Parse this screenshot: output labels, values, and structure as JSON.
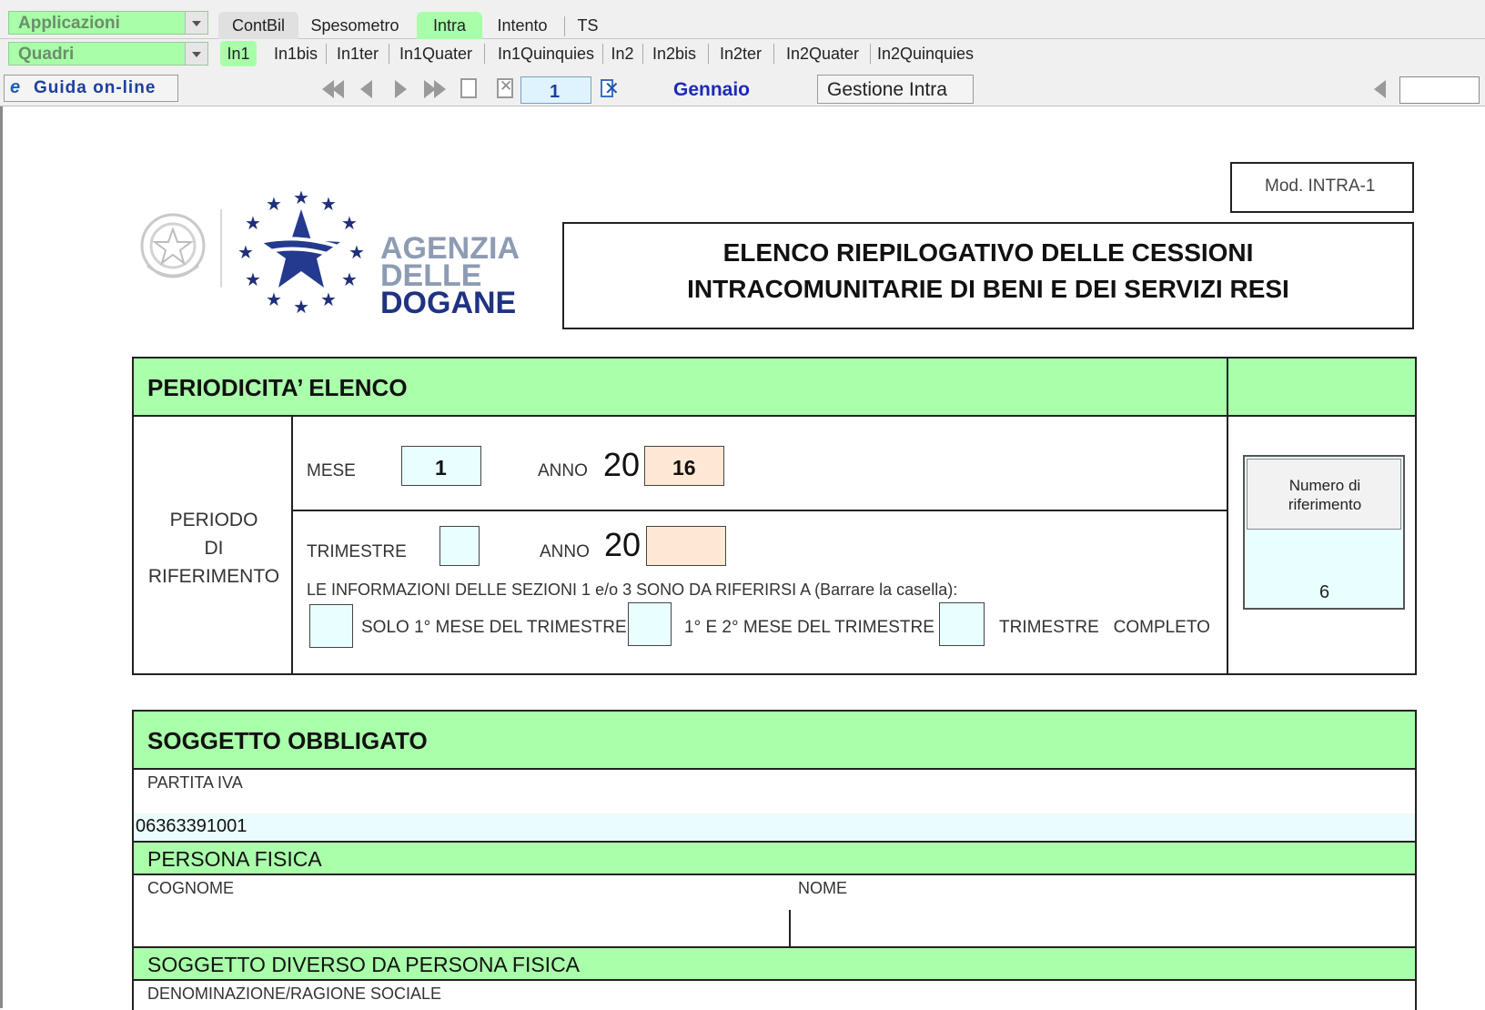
{
  "toolbar": {
    "app_combo": "Applicazioni",
    "quadri_combo": "Quadri",
    "main_tabs": [
      "ContBil",
      "Spesometro",
      "Intra",
      "Intento",
      "TS"
    ],
    "sub_tabs": [
      "In1",
      "In1bis",
      "In1ter",
      "In1Quater",
      "In1Quinquies",
      "In2",
      "In2bis",
      "In2ter",
      "In2Quater",
      "In2Quinquies"
    ],
    "guida": "Guida on-line",
    "page_number": "1",
    "month": "Gennaio",
    "gestione": "Gestione Intra"
  },
  "header": {
    "mod": "Mod. INTRA-1",
    "agency_line1": "AGENZIA",
    "agency_line2": "DELLE",
    "agency_line3": "DOGANE",
    "title_line1": "ELENCO RIEPILOGATIVO DELLE CESSIONI",
    "title_line2": "INTRACOMUNITARIE DI BENI E DEI SERVIZI RESI"
  },
  "periodicita": {
    "title": "PERIODICITA’ ELENCO",
    "periodo_line1": "PERIODO",
    "periodo_line2": "DI",
    "periodo_line3": "RIFERIMENTO",
    "mese_label": "MESE",
    "mese_value": "1",
    "anno_label": "ANNO",
    "anno_prefix": "20",
    "anno_value": "16",
    "trimestre_label": "TRIMESTRE",
    "anno2_label": "ANNO",
    "anno2_prefix": "20",
    "info_text": "LE INFORMAZIONI DELLE SEZIONI 1 e/o 3 SONO DA RIFERIRSI A (Barrare la casella):",
    "opt1": "SOLO 1° MESE DEL TRIMESTRE",
    "opt2": "1° E 2° MESE DEL TRIMESTRE",
    "opt3": "TRIMESTRE   COMPLETO",
    "numero_rif_label": "Numero di riferimento",
    "numero_rif_value": "6"
  },
  "soggetto": {
    "title": "SOGGETTO OBBLIGATO",
    "partita_label": "PARTITA IVA",
    "partita_value": "06363391001",
    "persona_fisica": "PERSONA FISICA",
    "cognome": "COGNOME",
    "nome": "NOME",
    "diverso": "SOGGETTO DIVERSO DA PERSONA FISICA",
    "denominazione": "DENOMINAZIONE/RAGIONE SOCIALE"
  }
}
